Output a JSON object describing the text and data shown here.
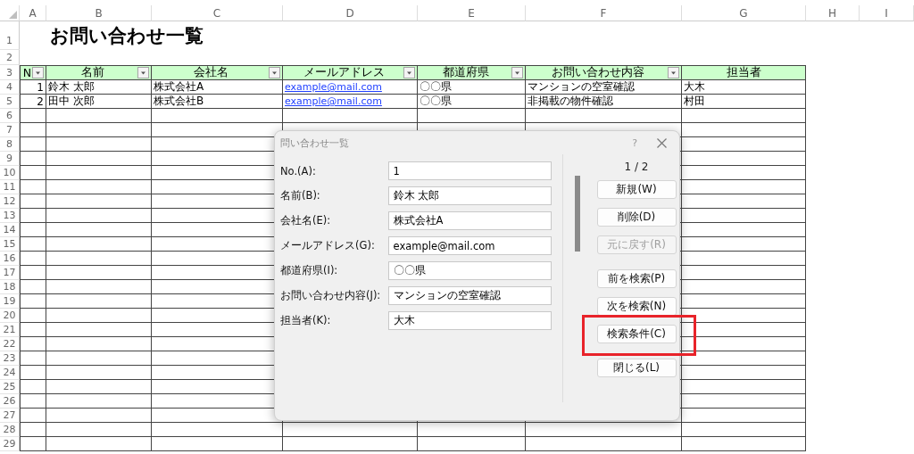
{
  "sheet": {
    "column_letters": [
      "A",
      "B",
      "C",
      "D",
      "E",
      "F",
      "G",
      "H",
      "I"
    ],
    "row_numbers": [
      "1",
      "2",
      "3",
      "4",
      "5",
      "6",
      "7",
      "8",
      "9",
      "10",
      "11",
      "12",
      "13",
      "14",
      "15",
      "16",
      "17",
      "18",
      "19",
      "20",
      "21",
      "22",
      "23",
      "24",
      "25",
      "26",
      "27",
      "28",
      "29"
    ],
    "title": "お問い合わせ一覧",
    "table": {
      "columns": [
        {
          "label": "N",
          "filter": true,
          "kind": "number"
        },
        {
          "label": "名前",
          "filter": true,
          "kind": "text"
        },
        {
          "label": "会社名",
          "filter": true,
          "kind": "text"
        },
        {
          "label": "メールアドレス",
          "filter": true,
          "kind": "link"
        },
        {
          "label": "都道府県",
          "filter": true,
          "kind": "text"
        },
        {
          "label": "お問い合わせ内容",
          "filter": true,
          "kind": "text"
        },
        {
          "label": "担当者",
          "filter": false,
          "kind": "text"
        }
      ],
      "rows": [
        {
          "cells": [
            "1",
            "鈴木 太郎",
            "株式会社A",
            "example@mail.com",
            "〇〇県",
            "マンションの空室確認",
            "大木"
          ]
        },
        {
          "cells": [
            "2",
            "田中 次郎",
            "株式会社B",
            "example@mail.com",
            "〇〇県",
            "非掲載の物件確認",
            "村田"
          ]
        }
      ]
    }
  },
  "dialog": {
    "title": "問い合わせ一覧",
    "help": "?",
    "fields": [
      {
        "label": "No.(A):",
        "value": "1"
      },
      {
        "label": "名前(B):",
        "value": "鈴木 太郎"
      },
      {
        "label": "会社名(E):",
        "value": "株式会社A"
      },
      {
        "label": "メールアドレス(G):",
        "value": "example@mail.com"
      },
      {
        "label": "都道府県(I):",
        "value": "〇〇県"
      },
      {
        "label": "お問い合わせ内容(J):",
        "value": "マンションの空室確認"
      },
      {
        "label": "担当者(K):",
        "value": "大木"
      }
    ],
    "record_position": "1 / 2",
    "button_groups": [
      [
        {
          "label": "新規(W)",
          "disabled": false,
          "highlighted": false
        },
        {
          "label": "削除(D)",
          "disabled": false,
          "highlighted": false
        },
        {
          "label": "元に戻す(R)",
          "disabled": true,
          "highlighted": false
        }
      ],
      [
        {
          "label": "前を検索(P)",
          "disabled": false,
          "highlighted": false
        },
        {
          "label": "次を検索(N)",
          "disabled": false,
          "highlighted": false
        },
        {
          "label": "検索条件(C)",
          "disabled": false,
          "highlighted": true
        }
      ],
      [
        {
          "label": "閉じる(L)",
          "disabled": false,
          "highlighted": false
        }
      ]
    ]
  }
}
